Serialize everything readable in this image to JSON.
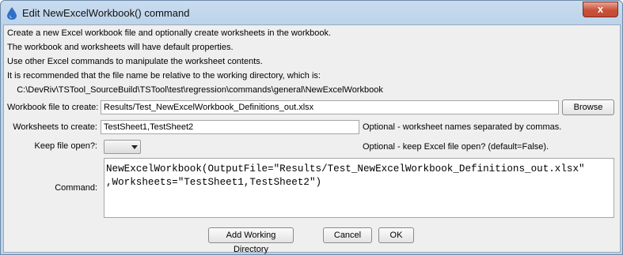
{
  "window": {
    "title": "Edit NewExcelWorkbook() command",
    "close_glyph": "x"
  },
  "description": [
    "Create a new Excel workbook file and optionally create worksheets in the workbook.",
    "The workbook and worksheets will have default properties.",
    "Use other Excel commands to manipulate the worksheet contents.",
    "It is recommended that the file name be relative to the working directory, which is:",
    "    C:\\DevRiv\\TSTool_SourceBuild\\TSTool\\test\\regression\\commands\\general\\NewExcelWorkbook"
  ],
  "form": {
    "workbook_label": "Workbook file to create:",
    "workbook_value": "Results/Test_NewExcelWorkbook_Definitions_out.xlsx",
    "browse_label": "Browse",
    "worksheets_label": "Worksheets to create:",
    "worksheets_value": "TestSheet1,TestSheet2",
    "worksheets_note": "Optional - worksheet names separated by commas.",
    "keepopen_label": "Keep file open?:",
    "keepopen_value": "",
    "keepopen_note": "Optional - keep Excel file open? (default=False).",
    "command_label": "Command:",
    "command_line1": "NewExcelWorkbook(OutputFile=\"Results/Test_NewExcelWorkbook_Definitions_out.xlsx\"",
    "command_line2": ",Worksheets=\"TestSheet1,TestSheet2\")"
  },
  "buttons": {
    "add_working_directory": "Add Working Directory",
    "cancel": "Cancel",
    "ok": "OK"
  },
  "icons": {
    "app": "water-drop-icon",
    "close": "close-icon",
    "dropdown": "chevron-down-icon"
  },
  "colors": {
    "title_gradient_top": "#c9dcf0",
    "close_button": "#c8513a",
    "client_background": "#efefef"
  }
}
